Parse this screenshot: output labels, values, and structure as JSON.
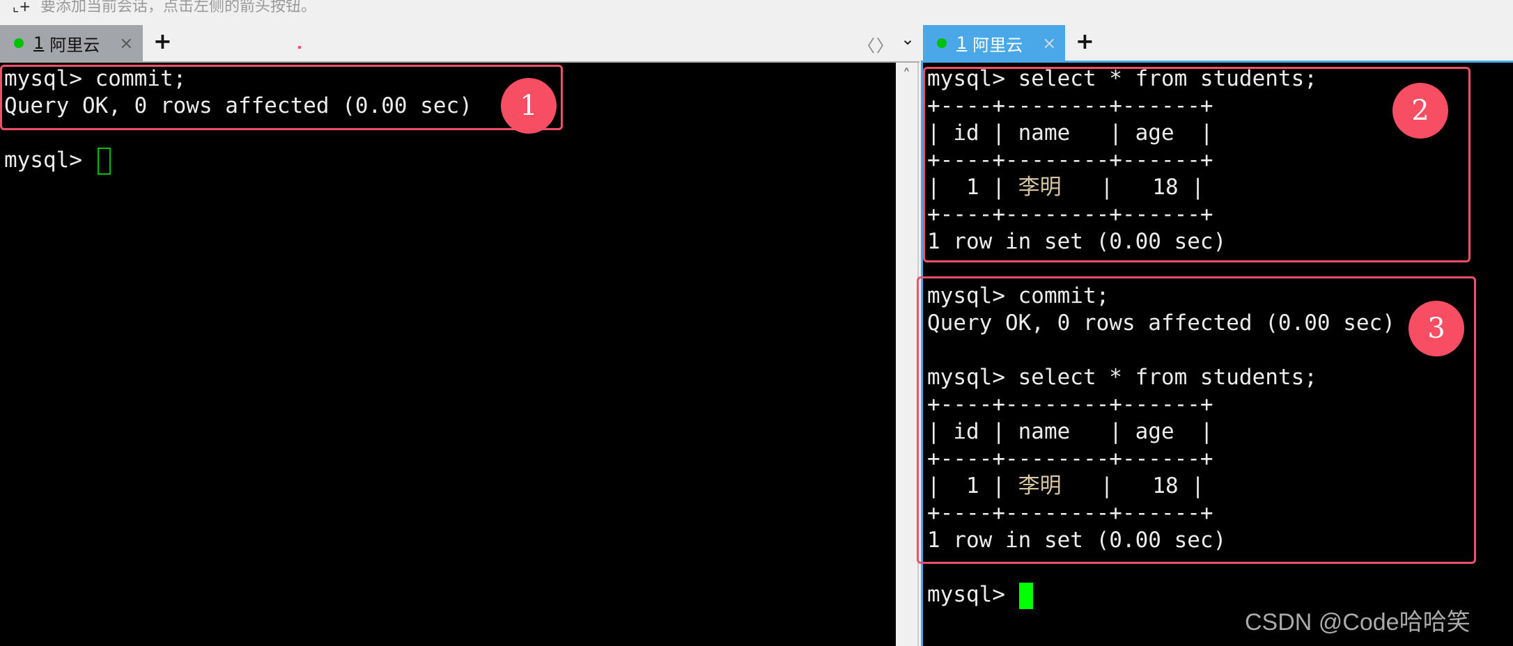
{
  "hint": {
    "icon": "add-session-icon",
    "text": "要添加当前会话，点击左侧的箭头按钮。"
  },
  "left_tab": {
    "num": "1",
    "label": "阿里云",
    "close": "×",
    "status_color": "#00c000"
  },
  "right_tab": {
    "num": "1",
    "label": "阿里云",
    "close": "×",
    "status_color": "#00c000"
  },
  "add_tab": "+",
  "nav": {
    "prev": "〈",
    "next": "〉",
    "menu": "⌄"
  },
  "scroll_up": "˄",
  "left_terminal": {
    "lines": [
      "mysql> commit;",
      "Query OK, 0 rows affected (0.00 sec)",
      "",
      "mysql> "
    ]
  },
  "right_terminal": {
    "block1": [
      "mysql> select * from students;",
      "+----+--------+------+",
      "| id | name   | age  |",
      "+----+--------+------+"
    ],
    "row1_pre": "|  1 | ",
    "row1_name": "李明",
    "row1_post": "   |   18 |",
    "block1_end": [
      "+----+--------+------+",
      "1 row in set (0.00 sec)",
      "",
      "mysql> commit;",
      "Query OK, 0 rows affected (0.00 sec)",
      "",
      "mysql> select * from students;",
      "+----+--------+------+",
      "| id | name   | age  |",
      "+----+--------+------+"
    ],
    "block2_end": [
      "+----+--------+------+",
      "1 row in set (0.00 sec)",
      "",
      "mysql> "
    ]
  },
  "annotations": [
    "1",
    "2",
    "3"
  ],
  "watermark": "CSDN @Code哈哈笑",
  "colors": {
    "annotation": "#f74e63",
    "active_tab": "#4aa8e8",
    "cursor": "#00ff00"
  }
}
